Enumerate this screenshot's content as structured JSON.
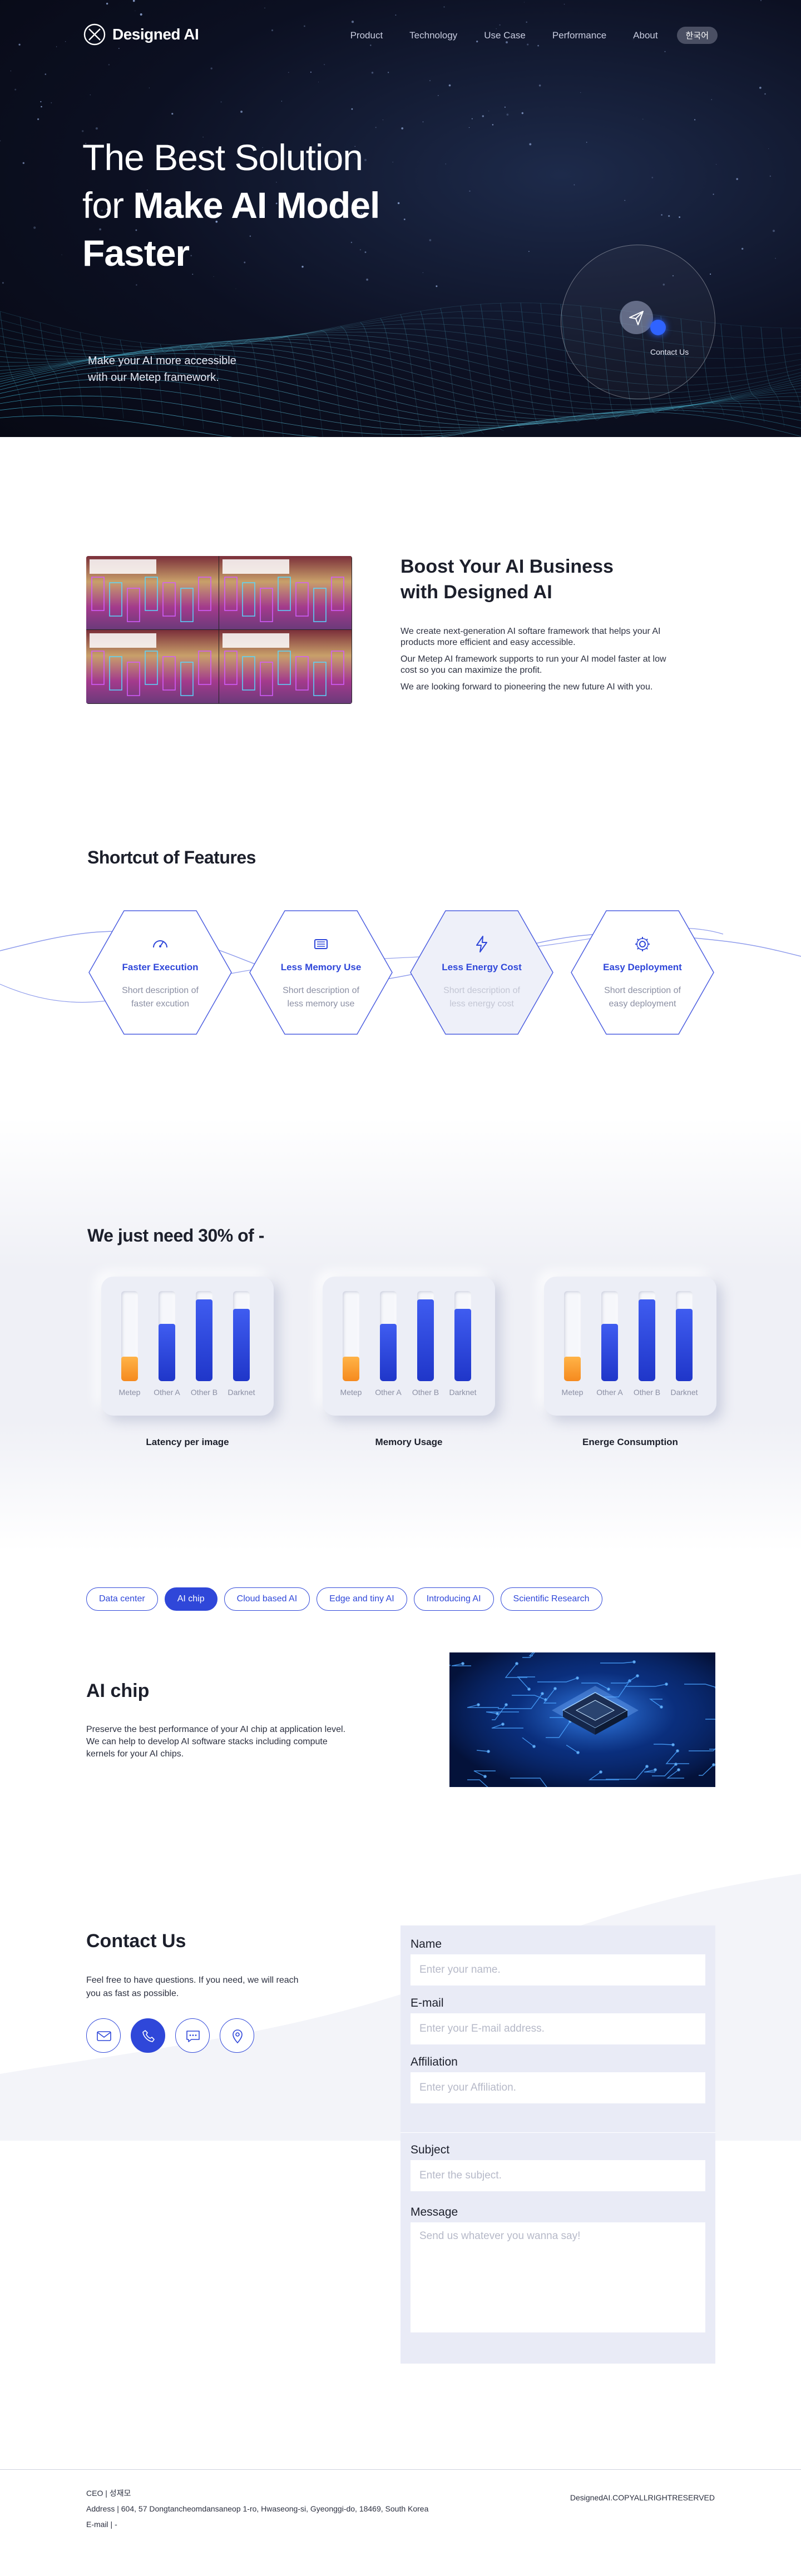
{
  "nav": {
    "brand": "Designed AI",
    "items": [
      "Product",
      "Technology",
      "Use Case",
      "Performance",
      "About"
    ],
    "language": "한국어"
  },
  "hero": {
    "title_line1": "The Best Solution",
    "title_line2_light": "for ",
    "title_line2_bold": "Make AI Model",
    "title_line3": "Faster",
    "subtitle": "Make your AI more accessible with our Metep framework.",
    "contact_label": "Contact Us"
  },
  "about": {
    "title": "Boost Your AI Business with Designed AI",
    "paragraphs": [
      "We  create next-generation AI softare framework that helps your AI products more efficient and easy accessible.",
      "Our Metep AI framework supports to run your AI model faster at low cost so you can maximize the profit.",
      "We are looking forward to pioneering the new future AI with you."
    ]
  },
  "features": {
    "title": "Shortcut of Features",
    "items": [
      {
        "title": "Faster Execution",
        "desc": "Short description of faster excution",
        "icon": "gauge-icon"
      },
      {
        "title": "Less Memory Use",
        "desc": "Short description of less memory use",
        "icon": "memory-chip-icon"
      },
      {
        "title": "Less Energy Cost",
        "desc": "Short description of less energy cost",
        "icon": "lightning-icon"
      },
      {
        "title": "Easy Deployment",
        "desc": "Short description of easy deployment",
        "icon": "gear-icon"
      }
    ]
  },
  "performance": {
    "title": "We just need 30% of -",
    "chart_data": [
      {
        "type": "bar",
        "title": "Latency per image",
        "categories": [
          "Metep",
          "Other A",
          "Other B",
          "Darknet"
        ],
        "values": [
          0.3,
          0.7,
          1.0,
          0.88
        ],
        "colors": [
          "#f58a1f",
          "#2f47d9",
          "#2f47d9",
          "#2f47d9"
        ],
        "ylim": [
          0,
          1.1
        ]
      },
      {
        "type": "bar",
        "title": "Memory Usage",
        "categories": [
          "Metep",
          "Other A",
          "Other B",
          "Darknet"
        ],
        "values": [
          0.3,
          0.7,
          1.0,
          0.88
        ],
        "colors": [
          "#f58a1f",
          "#2f47d9",
          "#2f47d9",
          "#2f47d9"
        ],
        "ylim": [
          0,
          1.1
        ]
      },
      {
        "type": "bar",
        "title": "Energe Consumption",
        "categories": [
          "Metep",
          "Other A",
          "Other B",
          "Darknet"
        ],
        "values": [
          0.3,
          0.7,
          1.0,
          0.88
        ],
        "colors": [
          "#f58a1f",
          "#2f47d9",
          "#2f47d9",
          "#2f47d9"
        ],
        "ylim": [
          0,
          1.1
        ]
      }
    ]
  },
  "usecase": {
    "tabs": [
      "Data center",
      "AI chip",
      "Cloud based AI",
      "Edge and tiny AI",
      "Introducing AI",
      "Scientific Research"
    ],
    "active_tab": "AI chip",
    "title": "AI chip",
    "description": "Preserve the best performance of your AI chip at application level. We can help to develop AI software stacks including compute kernels for your AI chips."
  },
  "contact": {
    "title": "Contact Us",
    "description": "Feel free to have questions. If you need, we will reach you as fast as possible.",
    "icons": [
      "mail-icon",
      "phone-icon",
      "chat-icon",
      "location-pin-icon"
    ],
    "fields": {
      "name_label": "Name",
      "name_placeholder": "Enter your name.",
      "email_label": "E-mail",
      "email_placeholder": "Enter your E-mail address.",
      "affiliation_label": "Affiliation",
      "affiliation_placeholder": "Enter your Affiliation.",
      "subject_label": "Subject",
      "subject_placeholder": "Enter the subject.",
      "message_label": "Message",
      "message_placeholder": "Send us whatever you wanna say!"
    }
  },
  "footer": {
    "ceo": "CEO  |  성재모",
    "address": "Address  |  604, 57 Dongtancheomdansaneop 1-ro, Hwaseong-si, Gyeonggi-do, 18469, South Korea",
    "email": "E-mail  |  -",
    "copyright": "DesignedAI.COPYALLRIGHTRESERVED"
  },
  "colors": {
    "accent": "#2f47d9",
    "highlight": "#f58a1f",
    "hero_bg": "#0c1022",
    "form_bg": "#e9ebf6"
  }
}
